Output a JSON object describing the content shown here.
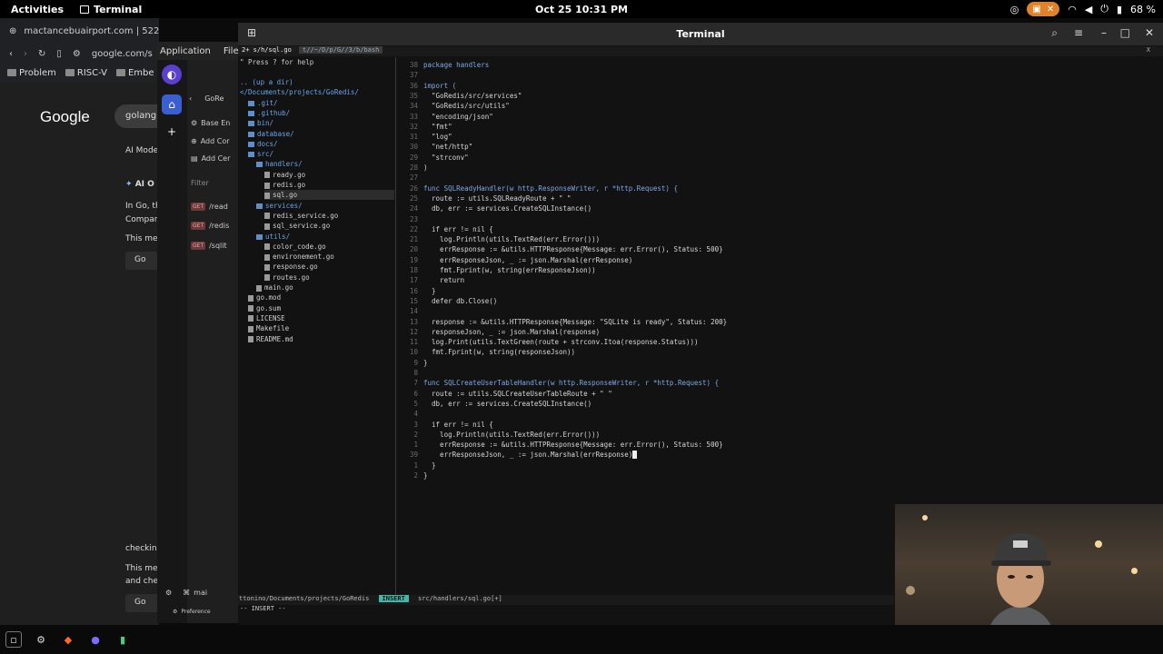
{
  "topbar": {
    "activities": "Activities",
    "app_name": "Terminal",
    "clock": "Oct 25  10:31 PM",
    "battery": "68 %"
  },
  "browser": {
    "tab_title": "mactancebuairport.com | 522",
    "url": "google.com/s",
    "bookmarks": [
      "Problem",
      "RISC-V",
      "Embe"
    ],
    "google_logo": "Google",
    "search_text": "golang",
    "ai_mode": "AI Mode",
    "ai_overview": "AI O",
    "texts": [
      "In Go, th",
      "Compar",
      "This me",
      "checkin",
      "This me",
      "and che"
    ],
    "go_label": "Go"
  },
  "postman": {
    "menu": [
      "Application",
      "File"
    ],
    "collection": "GoRe",
    "items": [
      "Base En",
      "Add Cor",
      "Add Cer"
    ],
    "filter": "Filter",
    "requests": [
      {
        "method": "GET",
        "path": "/read"
      },
      {
        "method": "GET",
        "path": "/redis"
      },
      {
        "method": "GET",
        "path": "/sqlit"
      }
    ],
    "bottom": [
      "mai",
      "Preference"
    ]
  },
  "terminal": {
    "title": "Terminal",
    "tabline": {
      "active": "2+ s/h/sql.go",
      "other": "t//~/D/p/G//3/b/bash"
    },
    "help_hint": "\" Press ? for help",
    "tree": [
      {
        "text": ".. (up a dir)",
        "kind": "root",
        "indent": 0
      },
      {
        "text": "</Documents/projects/GoRedis/",
        "kind": "root",
        "indent": 0
      },
      {
        "text": ".git/",
        "kind": "dir",
        "indent": 1
      },
      {
        "text": ".github/",
        "kind": "dir",
        "indent": 1
      },
      {
        "text": "bin/",
        "kind": "dir",
        "indent": 1
      },
      {
        "text": "database/",
        "kind": "dir",
        "indent": 1
      },
      {
        "text": "docs/",
        "kind": "dir",
        "indent": 1
      },
      {
        "text": "src/",
        "kind": "dir",
        "indent": 1
      },
      {
        "text": "handlers/",
        "kind": "dir",
        "indent": 2
      },
      {
        "text": "ready.go",
        "kind": "file",
        "indent": 3
      },
      {
        "text": "redis.go",
        "kind": "file",
        "indent": 3
      },
      {
        "text": "sql.go",
        "kind": "file",
        "indent": 3,
        "selected": true
      },
      {
        "text": "services/",
        "kind": "dir",
        "indent": 2
      },
      {
        "text": "redis_service.go",
        "kind": "file",
        "indent": 3
      },
      {
        "text": "sql_service.go",
        "kind": "file",
        "indent": 3
      },
      {
        "text": "utils/",
        "kind": "dir",
        "indent": 2
      },
      {
        "text": "color_code.go",
        "kind": "file",
        "indent": 3
      },
      {
        "text": "environement.go",
        "kind": "file",
        "indent": 3
      },
      {
        "text": "response.go",
        "kind": "file",
        "indent": 3
      },
      {
        "text": "routes.go",
        "kind": "file",
        "indent": 3
      },
      {
        "text": "main.go",
        "kind": "file",
        "indent": 2
      },
      {
        "text": "go.mod",
        "kind": "file",
        "indent": 1
      },
      {
        "text": "go.sum",
        "kind": "file",
        "indent": 1
      },
      {
        "text": "LICENSE",
        "kind": "file",
        "indent": 1
      },
      {
        "text": "Makefile",
        "kind": "file",
        "indent": 1
      },
      {
        "text": "README.md",
        "kind": "file",
        "indent": 1
      }
    ],
    "code": [
      {
        "n": "38",
        "t": "package handlers"
      },
      {
        "n": "37",
        "t": ""
      },
      {
        "n": "36",
        "t": "import ("
      },
      {
        "n": "35",
        "t": "  \"GoRedis/src/services\""
      },
      {
        "n": "34",
        "t": "  \"GoRedis/src/utils\""
      },
      {
        "n": "33",
        "t": "  \"encoding/json\""
      },
      {
        "n": "32",
        "t": "  \"fmt\""
      },
      {
        "n": "31",
        "t": "  \"log\""
      },
      {
        "n": "30",
        "t": "  \"net/http\""
      },
      {
        "n": "29",
        "t": "  \"strconv\""
      },
      {
        "n": "28",
        "t": ")"
      },
      {
        "n": "27",
        "t": ""
      },
      {
        "n": "26",
        "t": "func SQLReadyHandler(w http.ResponseWriter, r *http.Request) {"
      },
      {
        "n": "25",
        "t": "  route := utils.SQLReadyRoute + \" \""
      },
      {
        "n": "24",
        "t": "  db, err := services.CreateSQLInstance()"
      },
      {
        "n": "23",
        "t": ""
      },
      {
        "n": "22",
        "t": "  if err != nil {"
      },
      {
        "n": "21",
        "t": "    log.Println(utils.TextRed(err.Error()))"
      },
      {
        "n": "20",
        "t": "    errResponse := &utils.HTTPResponse{Message: err.Error(), Status: 500}"
      },
      {
        "n": "19",
        "t": "    errResponseJson, _ := json.Marshal(errResponse)"
      },
      {
        "n": "18",
        "t": "    fmt.Fprint(w, string(errResponseJson))"
      },
      {
        "n": "17",
        "t": "    return"
      },
      {
        "n": "16",
        "t": "  }"
      },
      {
        "n": "15",
        "t": "  defer db.Close()"
      },
      {
        "n": "14",
        "t": ""
      },
      {
        "n": "13",
        "t": "  response := &utils.HTTPResponse{Message: \"SQLite is ready\", Status: 200}"
      },
      {
        "n": "12",
        "t": "  responseJson, _ := json.Marshal(response)"
      },
      {
        "n": "11",
        "t": "  log.Print(utils.TextGreen(route + strconv.Itoa(response.Status)))"
      },
      {
        "n": "10",
        "t": "  fmt.Fprint(w, string(responseJson))"
      },
      {
        "n": "9",
        "t": "}"
      },
      {
        "n": "8",
        "t": ""
      },
      {
        "n": "7",
        "t": "func SQLCreateUserTableHandler(w http.ResponseWriter, r *http.Request) {"
      },
      {
        "n": "6",
        "t": "  route := utils.SQLCreateUserTableRoute + \" \""
      },
      {
        "n": "5",
        "t": "  db, err := services.CreateSQLInstance()"
      },
      {
        "n": "4",
        "t": ""
      },
      {
        "n": "3",
        "t": "  if err != nil {"
      },
      {
        "n": "2",
        "t": "    log.Println(utils.TextRed(err.Error()))"
      },
      {
        "n": "1",
        "t": "    errResponse := &utils.HTTPResponse{Message: err.Error(), Status: 500}"
      },
      {
        "n": "39",
        "t": "    errResponseJson, _ := json.Marshal(errResponse)"
      },
      {
        "n": "1",
        "t": "  }"
      },
      {
        "n": "2",
        "t": "}"
      }
    ],
    "status": {
      "path": "ttonino/Documents/projects/GoRedis",
      "mode": "INSERT",
      "file": "src/handlers/sql.go[+]"
    },
    "cmdline": "-- INSERT --"
  },
  "colors": {
    "accent": "#3fb8a8",
    "keyword": "#7fa8e6",
    "dir": "#6aa5e8"
  }
}
